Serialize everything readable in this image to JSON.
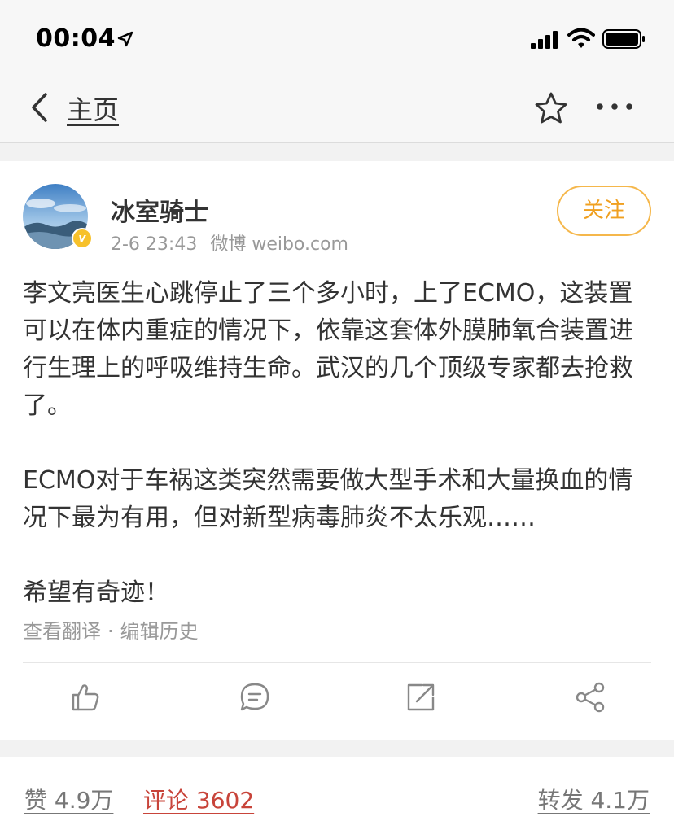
{
  "status_bar": {
    "time": "00:04",
    "icons": [
      "location-arrow-icon",
      "cellular-signal-icon",
      "wifi-icon",
      "battery-icon"
    ]
  },
  "nav": {
    "back_label": "主页",
    "icons": [
      "back-chevron-icon",
      "star-icon",
      "more-icon"
    ]
  },
  "post": {
    "author": "冰室骑士",
    "verified": true,
    "verified_mark": "v",
    "date": "2-6 23:43",
    "source": "微博 weibo.com",
    "follow_label": "关注",
    "paragraphs": [
      "李文亮医生心跳停止了三个多小时，上了ECMO，这装置可以在体内重症的情况下，依靠这套体外膜肺氧合装置进行生理上的呼吸维持生命。武汉的几个顶级专家都去抢救了。",
      "ECMO对于车祸这类突然需要做大型手术和大量换血的情况下最为有用，但对新型病毒肺炎不太乐观……",
      "希望有奇迹！"
    ],
    "translate_label": "查看翻译",
    "separator": "·",
    "edit_history_label": "编辑历史",
    "toolbar_icons": [
      "like-icon",
      "comment-icon",
      "repost-icon",
      "share-icon"
    ]
  },
  "stats": {
    "likes": "赞 4.9万",
    "comments": "评论 3602",
    "reposts": "转发 4.1万"
  },
  "colors": {
    "follow_accent": "#f0a020",
    "active_tab": "#c8443a",
    "verified_badge": "#f7c12b"
  }
}
